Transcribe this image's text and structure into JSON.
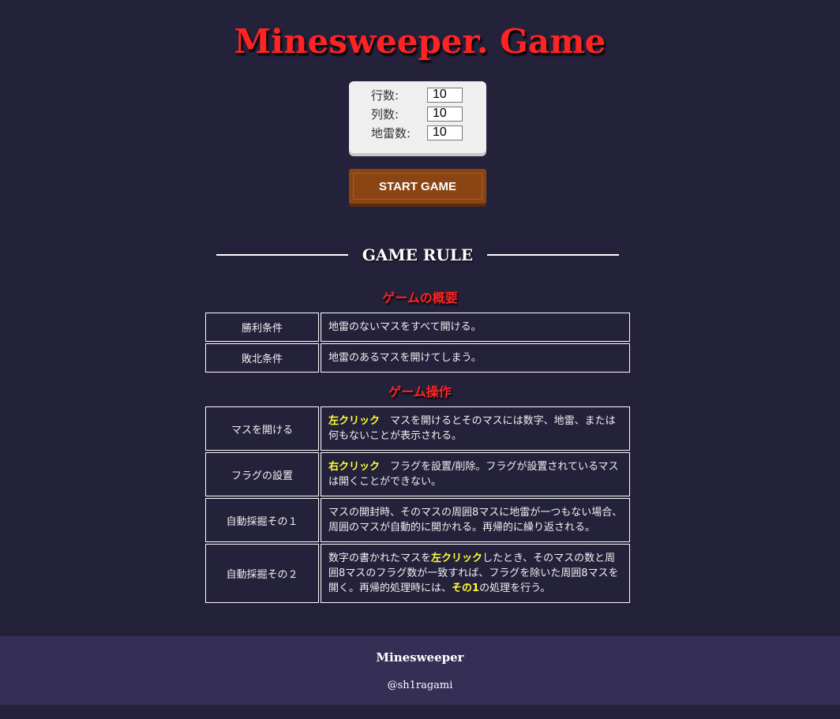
{
  "header": {
    "title": "Minesweeper. Game"
  },
  "settings": {
    "rows_label": "行数:",
    "rows_value": "10",
    "cols_label": "列数:",
    "cols_value": "10",
    "mines_label": "地雷数:",
    "mines_value": "10"
  },
  "start_button": {
    "label": "START GAME"
  },
  "rules": {
    "heading": "GAME RULE",
    "overview_title": "ゲームの概要",
    "overview": [
      {
        "label": "勝利条件",
        "desc": "地雷のないマスをすべて開ける。"
      },
      {
        "label": "敗北条件",
        "desc": "地雷のあるマスを開けてしまう。"
      }
    ],
    "operations_title": "ゲーム操作",
    "operations": [
      {
        "label": "マスを開ける",
        "key": "左クリック",
        "desc_rest": "　マスを開けるとそのマスには数字、地雷、または何もないことが表示される。"
      },
      {
        "label": "フラグの設置",
        "key": "右クリック",
        "desc_rest": "　フラグを設置/削除。フラグが設置されているマスは開くことができない。"
      },
      {
        "label": "自動採掘その１",
        "desc": "マスの開封時、そのマスの周囲8マスに地雷が一つもない場合、周囲のマスが自動的に開かれる。再帰的に繰り返される。"
      },
      {
        "label": "自動採掘その２",
        "desc_a": "数字の書かれたマスを",
        "key": "左クリック",
        "desc_b": "したとき、そのマスの数と周囲8マスのフラグ数が一致すれば、フラグを除いた周囲8マスを開く。再帰的処理時には、",
        "key2": "その1",
        "desc_c": "の処理を行う。"
      }
    ]
  },
  "footer": {
    "title": "Minesweeper",
    "credit": "@sh1ragami"
  },
  "colors": {
    "background": "#24213b",
    "title_red": "#ff2424",
    "label_green": "#2bd12b",
    "highlight_yellow": "#ffff33",
    "button_brown": "#8b4513",
    "footer_bg": "#352e55"
  }
}
